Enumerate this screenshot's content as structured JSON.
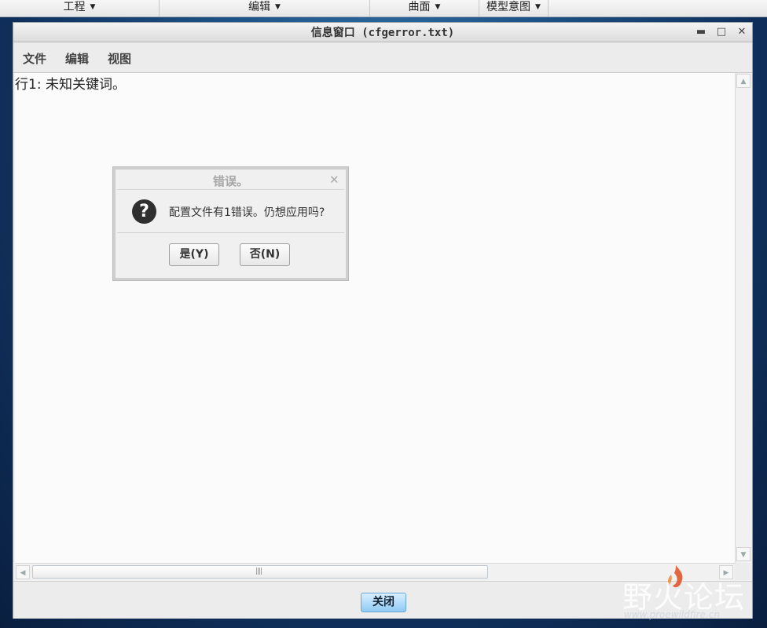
{
  "top_menu": [
    {
      "label": "工程"
    },
    {
      "label": "编辑"
    },
    {
      "label": "曲面"
    },
    {
      "label": "模型意图"
    }
  ],
  "info_window": {
    "title": "信息窗口 (cfgerror.txt)",
    "menu": [
      "文件",
      "编辑",
      "视图"
    ],
    "content": "行1: 未知关键词。",
    "close_label": "关闭"
  },
  "dialog": {
    "title": "错误。",
    "message": "配置文件有1错误。仍想应用吗?",
    "yes_label": "是(Y)",
    "no_label": "否(N)"
  },
  "watermark": {
    "text": "野火论坛",
    "url": "www.proewildfire.cn"
  }
}
